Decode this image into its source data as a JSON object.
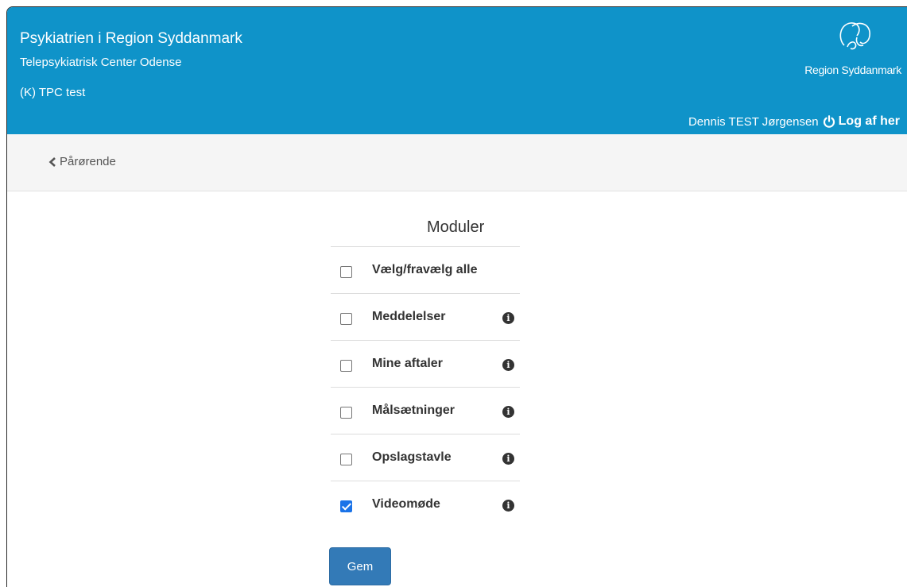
{
  "header": {
    "org_name": "Psykiatrien i Region Syddanmark",
    "center_name": "Telepsykiatrisk Center Odense",
    "unit_name": "(K) TPC test",
    "logo_text": "Region Syddanmark",
    "user_name": "Dennis TEST Jørgensen",
    "logout_label": "Log af her"
  },
  "nav": {
    "back_label": "Pårørende"
  },
  "modules": {
    "title": "Moduler",
    "select_all_label": "Vælg/fravælg alle",
    "items": [
      {
        "label": "Meddelelser",
        "checked": false
      },
      {
        "label": "Mine aftaler",
        "checked": false
      },
      {
        "label": "Målsætninger",
        "checked": false
      },
      {
        "label": "Opslagstavle",
        "checked": false
      },
      {
        "label": "Videomøde",
        "checked": true
      }
    ]
  },
  "actions": {
    "save_label": "Gem"
  },
  "colors": {
    "header_bg": "#0f93c9",
    "primary_button": "#337ab7",
    "checkbox_checked": "#1a73e8"
  }
}
